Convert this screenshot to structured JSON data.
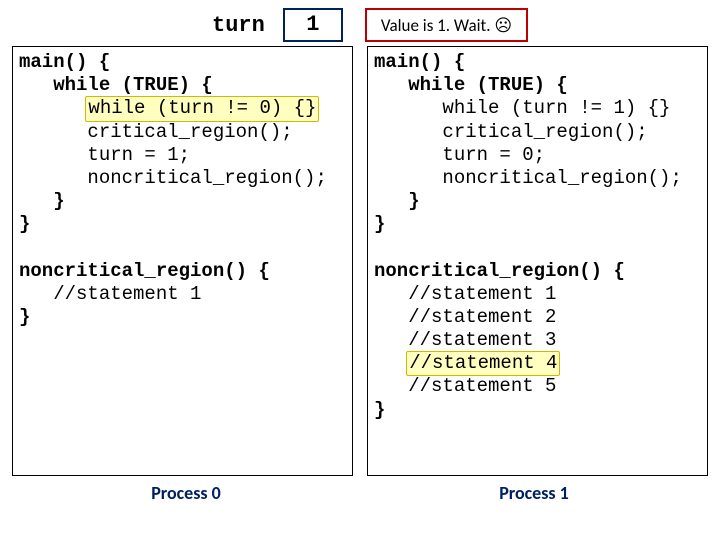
{
  "top": {
    "turn_label": "turn",
    "turn_value": "1",
    "value_text": "Value is 1. Wait. ☹"
  },
  "left": {
    "main_sig": "main() {",
    "while_true": "   while (TRUE) {",
    "while_turn": "while (turn != 0) {}",
    "crit": "      critical_region();",
    "assign": "      turn = 1;",
    "noncrit": "      noncritical_region();",
    "close_inner": "   }",
    "close_outer": "}",
    "ncr_sig": "noncritical_region() {",
    "stmt1": "   //statement 1",
    "ncr_close": "}"
  },
  "right": {
    "main_sig": "main() {",
    "while_true": "   while (TRUE) {",
    "while_turn": "      while (turn != 1) {}",
    "crit": "      critical_region();",
    "assign": "      turn = 0;",
    "noncrit": "      noncritical_region();",
    "close_inner": "   }",
    "close_outer": "}",
    "ncr_sig": "noncritical_region() {",
    "stmt1": "   //statement 1",
    "stmt2": "   //statement 2",
    "stmt3": "   //statement 3",
    "stmt4": "//statement 4",
    "stmt5": "   //statement 5",
    "ncr_close": "}"
  },
  "footer": {
    "left": "Process 0",
    "right": "Process 1"
  }
}
